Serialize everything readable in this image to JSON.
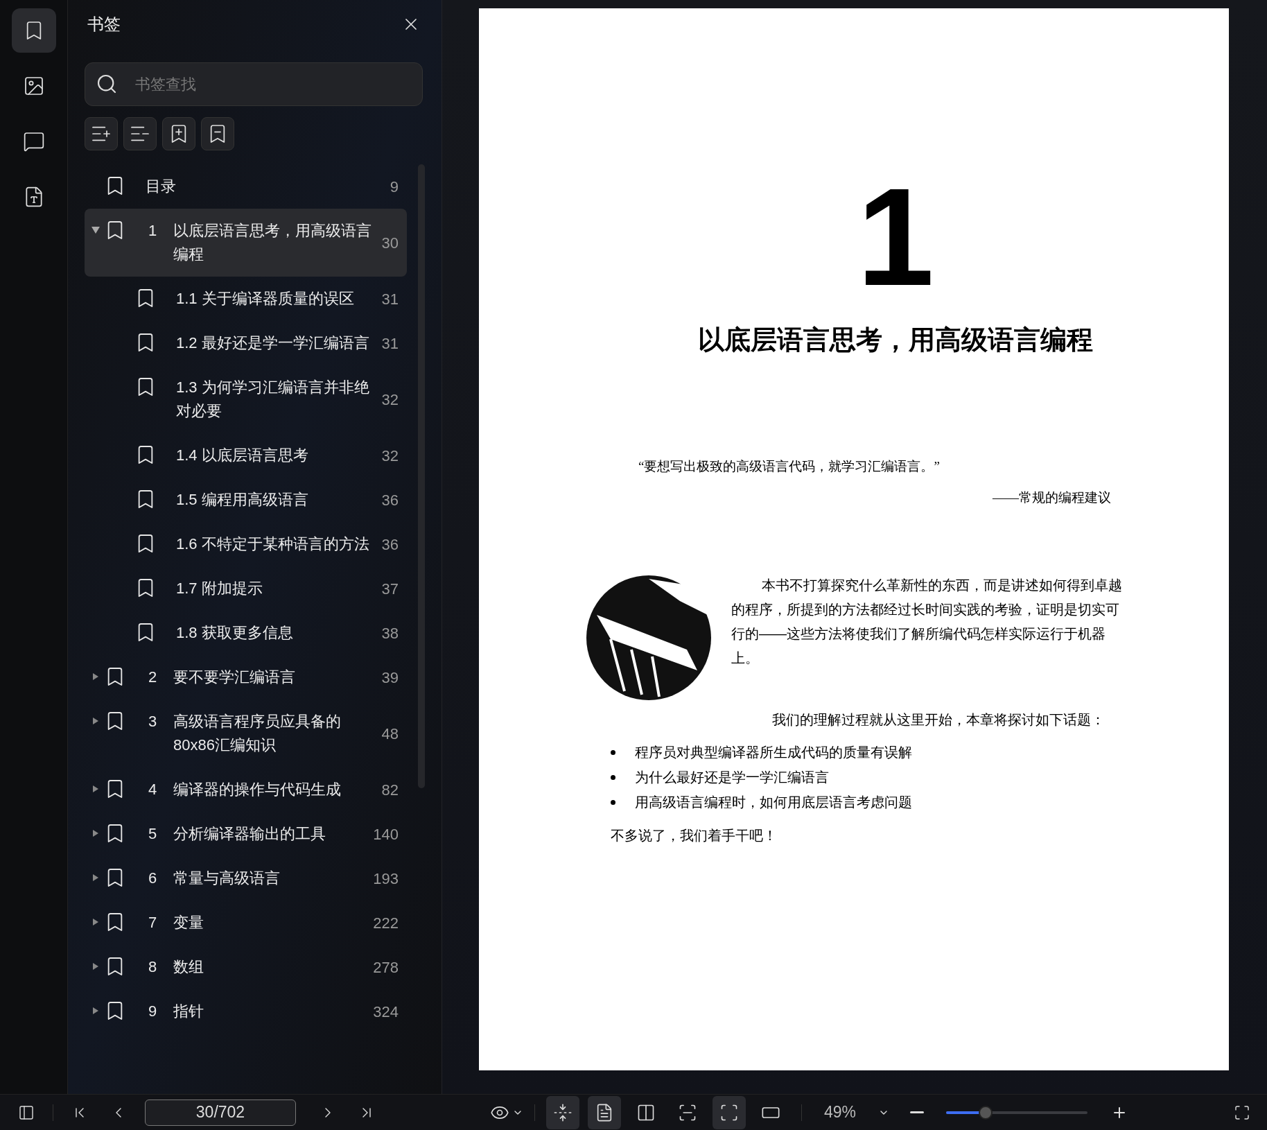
{
  "rail": [
    {
      "kind": "bookmark",
      "selected": true
    },
    {
      "kind": "image",
      "selected": false
    },
    {
      "kind": "comment",
      "selected": false
    },
    {
      "kind": "convert",
      "selected": false
    }
  ],
  "panel": {
    "title": "书签",
    "search": {
      "placeholder": "书签查找"
    }
  },
  "bookmarks": [
    {
      "title": "目录",
      "page": "9",
      "selected": false
    },
    {
      "number": "1",
      "title": "以底层语言思考，用高级语言编程",
      "page": "30",
      "selected": true,
      "expanded": true,
      "children": [
        {
          "title": "1.1 关于编译器质量的误区",
          "page": "31",
          "selected": false
        },
        {
          "title": "1.2 最好还是学一学汇编语言",
          "page": "31",
          "selected": false
        },
        {
          "title": "1.3 为何学习汇编语言并非绝对必要",
          "page": "32",
          "selected": false
        },
        {
          "title": "1.4 以底层语言思考",
          "page": "32",
          "selected": false
        },
        {
          "title": "1.5 编程用高级语言",
          "page": "36",
          "selected": false
        },
        {
          "title": "1.6 不特定于某种语言的方法",
          "page": "36",
          "selected": false
        },
        {
          "title": "1.7 附加提示",
          "page": "37",
          "selected": false
        },
        {
          "title": "1.8 获取更多信息",
          "page": "38",
          "selected": false
        }
      ]
    },
    {
      "number": "2",
      "title": "要不要学汇编语言",
      "page": "39",
      "selected": false,
      "expanded": false
    },
    {
      "number": "3",
      "title": "高级语言程序员应具备的80x86汇编知识",
      "page": "48",
      "selected": false,
      "expanded": false
    },
    {
      "number": "4",
      "title": "编译器的操作与代码生成",
      "page": "82",
      "selected": false,
      "expanded": false
    },
    {
      "number": "5",
      "title": "分析编译器输出的工具",
      "page": "140",
      "selected": false,
      "expanded": false
    },
    {
      "number": "6",
      "title": "常量与高级语言",
      "page": "193",
      "selected": false,
      "expanded": false
    },
    {
      "number": "7",
      "title": "变量",
      "page": "222",
      "selected": false,
      "expanded": false
    },
    {
      "number": "8",
      "title": "数组",
      "page": "278",
      "selected": false,
      "expanded": false
    },
    {
      "number": "9",
      "title": "指针",
      "page": "324",
      "selected": false,
      "expanded": false
    }
  ],
  "page": {
    "chapter_number": "1",
    "chapter_title": "以底层语言思考，用高级语言编程",
    "quote": "“要想写出极致的高级语言代码，就学习汇编语言。”",
    "attribution": "——常规的编程建议",
    "paragraphs": [
      "本书不打算探究什么革新性的东西，而是讲述如何得到卓越的程序，所提到的方法都经过长时间实践的考验，证明是切实可行的——这些方法将使我们了解所编代码怎样实际运行于机器上。",
      "我们的理解过程就从这里开始，本章将探讨如下话题："
    ],
    "bullets": [
      "程序员对典型编译器所生成代码的质量有误解",
      "为什么最好还是学一学汇编语言",
      "用高级语言编程时，如何用底层语言考虑问题"
    ],
    "closing": "不多说了，我们着手干吧！"
  },
  "toolbar": {
    "page_field": "30/702",
    "views": [
      {
        "kind": "fit-width",
        "selected": true
      },
      {
        "kind": "single",
        "selected": true
      },
      {
        "kind": "double",
        "selected": false
      },
      {
        "kind": "actual",
        "selected": false
      },
      {
        "kind": "fit-page",
        "selected": true
      },
      {
        "kind": "rotate",
        "selected": false
      }
    ],
    "zoom": "49%",
    "zoom_slider": {
      "level": 0.28
    }
  }
}
